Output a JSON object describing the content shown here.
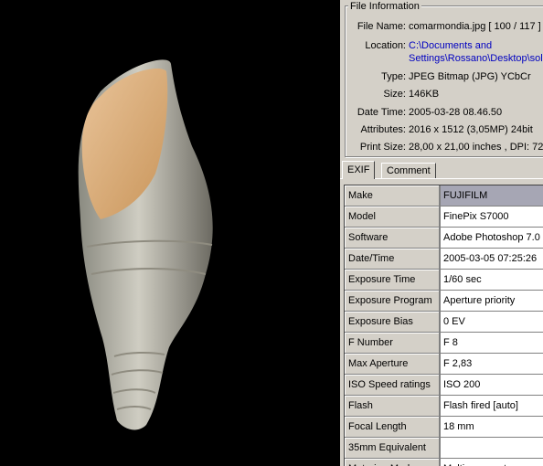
{
  "file_info": {
    "title": "File Information",
    "rows": [
      {
        "label": "File Name:",
        "value": "comarmondia.jpg   [ 100 / 117 ]"
      },
      {
        "label": "Location:",
        "value": "C:\\Documents and",
        "value2": "Settings\\Rossano\\Desktop\\solo"
      },
      {
        "label": "Type:",
        "value": "JPEG Bitmap (JPG) YCbCr"
      },
      {
        "label": "Size:",
        "value": "146KB"
      },
      {
        "label": "Date Time:",
        "value": "2005-03-28 08.46.50"
      },
      {
        "label": "Attributes:",
        "value": "2016 x 1512 (3,05MP)   24bit"
      },
      {
        "label": "Print Size:",
        "value": "28,00 x 21,00 inches ,   DPI: 72"
      }
    ]
  },
  "tabs": [
    "EXIF",
    "Comment"
  ],
  "exif": [
    {
      "key": "Make",
      "value": "FUJIFILM"
    },
    {
      "key": "Model",
      "value": "FinePix S7000"
    },
    {
      "key": "Software",
      "value": "Adobe Photoshop 7.0"
    },
    {
      "key": "Date/Time",
      "value": "2005-03-05 07:25:26"
    },
    {
      "key": "Exposure Time",
      "value": "1/60 sec"
    },
    {
      "key": "Exposure Program",
      "value": "Aperture priority"
    },
    {
      "key": "Exposure Bias",
      "value": "0 EV"
    },
    {
      "key": "F Number",
      "value": "F 8"
    },
    {
      "key": "Max Aperture",
      "value": "F 2,83"
    },
    {
      "key": "ISO Speed ratings",
      "value": "ISO 200"
    },
    {
      "key": "Flash",
      "value": "Flash fired [auto]"
    },
    {
      "key": "Focal Length",
      "value": "18 mm"
    },
    {
      "key": "35mm Equivalent",
      "value": ""
    },
    {
      "key": "Metering Mode",
      "value": "Multi-segment"
    }
  ]
}
